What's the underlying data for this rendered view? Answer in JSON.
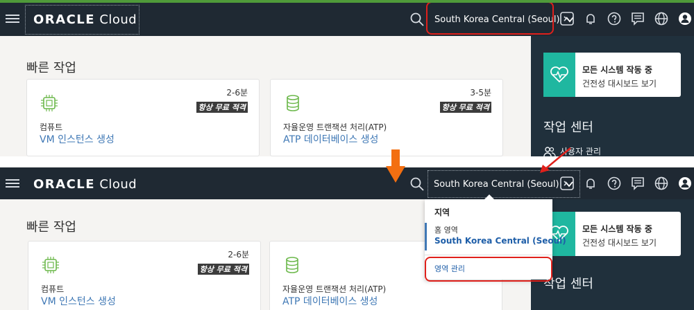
{
  "topbar": {
    "logo_brand": "ORACLE",
    "logo_product": "Cloud",
    "region_label": "South Korea Central (Seoul)"
  },
  "quick_actions": {
    "title": "빠른 작업",
    "cards": [
      {
        "duration": "2-6분",
        "tag": "항상 무료 적격",
        "kind": "컴퓨트",
        "link": "VM 인스턴스 생성"
      },
      {
        "duration": "3-5분",
        "tag": "항상 무료 적격",
        "kind": "자율운영 트랜잭션 처리(ATP)",
        "link": "ATP 데이터베이스 생성"
      }
    ]
  },
  "status_card": {
    "title": "모든 시스템 작동 중",
    "link": "건전성 대시보드 보기"
  },
  "work_center": {
    "title": "작업 센터",
    "item": "사용자 관리"
  },
  "region_menu": {
    "heading": "지역",
    "home_label": "홈 영역",
    "home_value": "South Korea Central (Seoul)",
    "manage_label": "영역 관리"
  },
  "icon_names": [
    "hamburger-icon",
    "search-icon",
    "chevron-down-icon",
    "cloud-shell-icon",
    "bell-icon",
    "help-icon",
    "chat-icon",
    "globe-icon",
    "user-icon"
  ],
  "colors": {
    "topbar": "#1f2933",
    "accent_blue": "#3f78b5",
    "highlight_red": "#e0201b",
    "arrow_orange": "#f36f11",
    "status_teal": "#1fb7a0"
  }
}
